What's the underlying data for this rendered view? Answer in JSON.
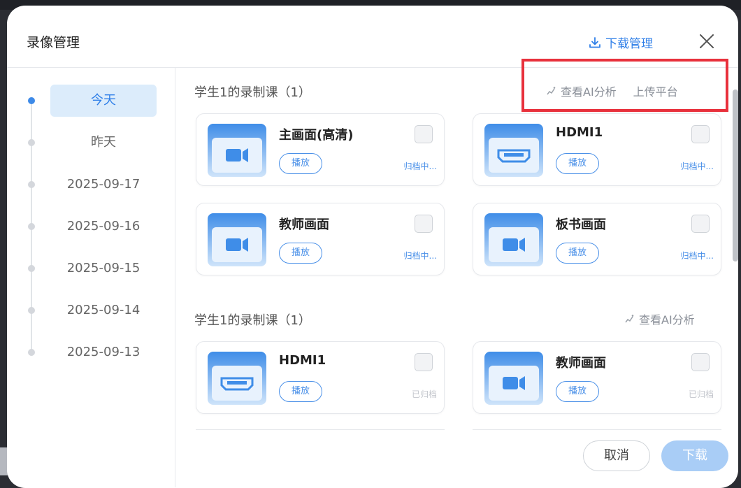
{
  "dialog": {
    "title": "录像管理",
    "download_manage": "下载管理"
  },
  "sidebar": {
    "dates": [
      {
        "label": "今天",
        "active": true
      },
      {
        "label": "昨天",
        "active": false
      },
      {
        "label": "2025-09-17",
        "active": false
      },
      {
        "label": "2025-09-16",
        "active": false
      },
      {
        "label": "2025-09-15",
        "active": false
      },
      {
        "label": "2025-09-14",
        "active": false
      },
      {
        "label": "2025-09-13",
        "active": false
      }
    ]
  },
  "sections": [
    {
      "title": "学生1的录制课（1）",
      "ai_label": "查看AI分析",
      "upload_label": "上传平台",
      "cards": [
        {
          "name": "主画面(高清)",
          "icon": "video-camera-icon",
          "play": "播放",
          "status": "归档中..."
        },
        {
          "name": "HDMI1",
          "icon": "hdmi-icon",
          "play": "播放",
          "status": "归档中..."
        },
        {
          "name": "教师画面",
          "icon": "video-camera-icon",
          "play": "播放",
          "status": "归档中..."
        },
        {
          "name": "板书画面",
          "icon": "video-camera-icon",
          "play": "播放",
          "status": "归档中..."
        }
      ]
    },
    {
      "title": "学生1的录制课（1）",
      "ai_label": "查看AI分析",
      "cards": [
        {
          "name": "HDMI1",
          "icon": "hdmi-icon",
          "play": "播放",
          "status": "已归档"
        },
        {
          "name": "教师画面",
          "icon": "video-camera-icon",
          "play": "播放",
          "status": "已归档"
        }
      ]
    }
  ],
  "footer": {
    "cancel": "取消",
    "download": "下载"
  },
  "colors": {
    "accent": "#2f7fe8",
    "highlight_box": "#e8313c",
    "thumb_top": "#3f8de8",
    "thumb_bottom": "#cfe4fa"
  }
}
